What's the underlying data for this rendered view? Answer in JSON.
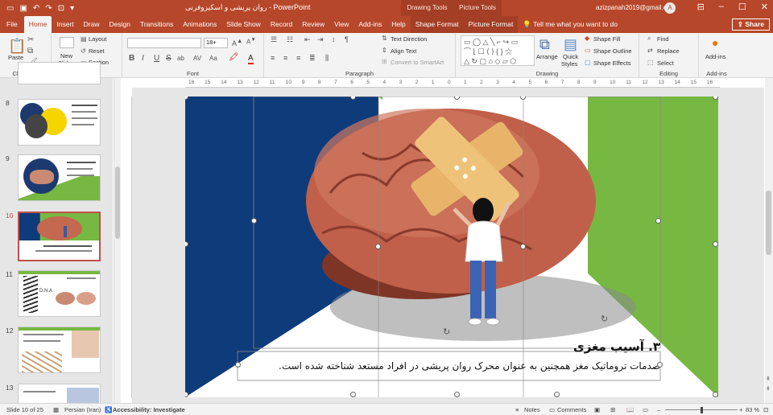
{
  "app": {
    "doc_title": "روان پریشی و اسکیزوفرنی  -  PowerPoint",
    "context_tools": [
      "Drawing Tools",
      "Picture Tools"
    ],
    "account": "azizpanah2019@gmail.com",
    "avatar_letter": "A",
    "accent": "#b7472a"
  },
  "tabs": [
    "File",
    "Home",
    "Insert",
    "Draw",
    "Design",
    "Transitions",
    "Animations",
    "Slide Show",
    "Record",
    "Review",
    "View",
    "Add-ins",
    "Help",
    "Shape Format",
    "Picture Format"
  ],
  "active_tab": "Home",
  "tell_me": "Tell me what you want to do",
  "share_label": "Share",
  "ribbon": {
    "clipboard": {
      "label": "Clipboard",
      "paste": "Paste"
    },
    "slides": {
      "label": "Slides",
      "new_slide": "New",
      "new_slide2": "Slide",
      "layout": "Layout",
      "reset": "Reset",
      "section": "Section"
    },
    "font": {
      "label": "Font",
      "size": "18+",
      "bold": "B",
      "italic": "I",
      "underline": "U",
      "strike": "S",
      "shadow": "ab",
      "font_color": "A"
    },
    "paragraph": {
      "label": "Paragraph",
      "text_direction": "Text Direction",
      "align_text": "Align Text",
      "smartart": "Convert to SmartArt"
    },
    "drawing": {
      "label": "Drawing",
      "arrange": "Arrange",
      "quick_styles1": "Quick",
      "quick_styles2": "Styles",
      "shape_fill": "Shape Fill",
      "shape_outline": "Shape Outline",
      "shape_effects": "Shape Effects"
    },
    "editing": {
      "label": "Editing",
      "find": "Find",
      "replace": "Replace",
      "select": "Select"
    },
    "addins": {
      "label": "Add-ins",
      "btn": "Add-ins"
    }
  },
  "ruler_numbers": [
    "16",
    "15",
    "14",
    "13",
    "12",
    "11",
    "10",
    "9",
    "8",
    "7",
    "6",
    "5",
    "4",
    "3",
    "2",
    "1",
    "0",
    "1",
    "2",
    "3",
    "4",
    "5",
    "6",
    "7",
    "8",
    "9",
    "10",
    "11",
    "12",
    "13",
    "14",
    "15",
    "16"
  ],
  "thumbnails": [
    {
      "num": "8"
    },
    {
      "num": "9"
    },
    {
      "num": "10"
    },
    {
      "num": "11"
    },
    {
      "num": "12"
    },
    {
      "num": "13"
    }
  ],
  "slide": {
    "heading": "۳. آسیب مغزی",
    "body": "صدمات تروماتیک مغز همچنین به عنوان محرک روان پریشی در افراد مستعد شناخته شده است.",
    "dna_label": "D.N.A"
  },
  "status": {
    "slide_of": "Slide 10 of 25",
    "language": "Persian (Iran)",
    "accessibility": "Accessibility: Investigate",
    "notes": "Notes",
    "comments": "Comments",
    "zoom": "83 %"
  }
}
